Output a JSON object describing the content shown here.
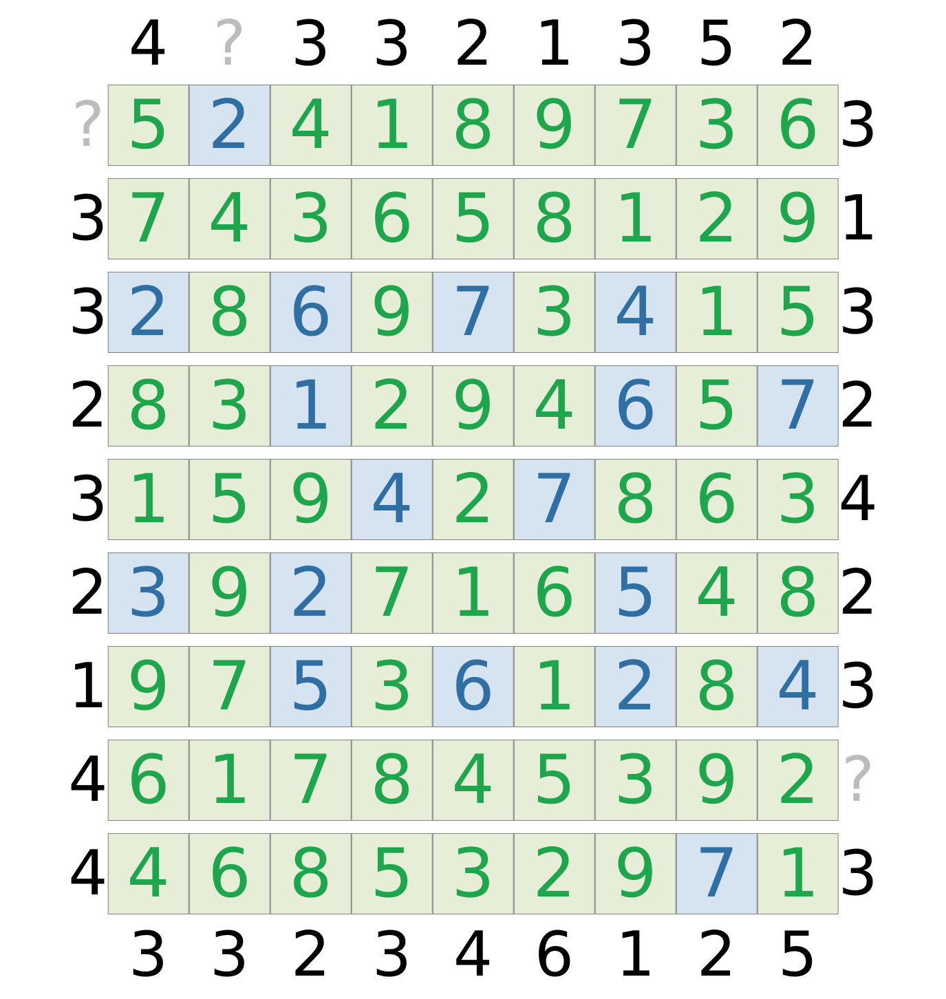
{
  "puzzle": {
    "type": "skyscrapers",
    "size": 9,
    "clues": {
      "top": [
        4,
        "?",
        3,
        3,
        2,
        1,
        3,
        5,
        2
      ],
      "bottom": [
        3,
        3,
        2,
        3,
        4,
        6,
        1,
        2,
        5
      ],
      "left": [
        "?",
        3,
        3,
        2,
        3,
        2,
        1,
        4,
        4
      ],
      "right": [
        3,
        1,
        3,
        2,
        4,
        2,
        3,
        "?",
        3
      ]
    },
    "grid": [
      [
        {
          "v": 5,
          "s": "green"
        },
        {
          "v": 2,
          "s": "blue"
        },
        {
          "v": 4,
          "s": "green"
        },
        {
          "v": 1,
          "s": "green"
        },
        {
          "v": 8,
          "s": "green"
        },
        {
          "v": 9,
          "s": "green"
        },
        {
          "v": 7,
          "s": "green"
        },
        {
          "v": 3,
          "s": "green"
        },
        {
          "v": 6,
          "s": "green"
        }
      ],
      [
        {
          "v": 7,
          "s": "green"
        },
        {
          "v": 4,
          "s": "green"
        },
        {
          "v": 3,
          "s": "green"
        },
        {
          "v": 6,
          "s": "green"
        },
        {
          "v": 5,
          "s": "green"
        },
        {
          "v": 8,
          "s": "green"
        },
        {
          "v": 1,
          "s": "green"
        },
        {
          "v": 2,
          "s": "green"
        },
        {
          "v": 9,
          "s": "green"
        }
      ],
      [
        {
          "v": 2,
          "s": "blue"
        },
        {
          "v": 8,
          "s": "green"
        },
        {
          "v": 6,
          "s": "blue"
        },
        {
          "v": 9,
          "s": "green"
        },
        {
          "v": 7,
          "s": "blue"
        },
        {
          "v": 3,
          "s": "green"
        },
        {
          "v": 4,
          "s": "blue"
        },
        {
          "v": 1,
          "s": "green"
        },
        {
          "v": 5,
          "s": "green"
        }
      ],
      [
        {
          "v": 8,
          "s": "green"
        },
        {
          "v": 3,
          "s": "green"
        },
        {
          "v": 1,
          "s": "blue"
        },
        {
          "v": 2,
          "s": "green"
        },
        {
          "v": 9,
          "s": "green"
        },
        {
          "v": 4,
          "s": "green"
        },
        {
          "v": 6,
          "s": "blue"
        },
        {
          "v": 5,
          "s": "green"
        },
        {
          "v": 7,
          "s": "blue"
        }
      ],
      [
        {
          "v": 1,
          "s": "green"
        },
        {
          "v": 5,
          "s": "green"
        },
        {
          "v": 9,
          "s": "green"
        },
        {
          "v": 4,
          "s": "blue"
        },
        {
          "v": 2,
          "s": "green"
        },
        {
          "v": 7,
          "s": "blue"
        },
        {
          "v": 8,
          "s": "green"
        },
        {
          "v": 6,
          "s": "green"
        },
        {
          "v": 3,
          "s": "green"
        }
      ],
      [
        {
          "v": 3,
          "s": "blue"
        },
        {
          "v": 9,
          "s": "green"
        },
        {
          "v": 2,
          "s": "blue"
        },
        {
          "v": 7,
          "s": "green"
        },
        {
          "v": 1,
          "s": "green"
        },
        {
          "v": 6,
          "s": "green"
        },
        {
          "v": 5,
          "s": "blue"
        },
        {
          "v": 4,
          "s": "green"
        },
        {
          "v": 8,
          "s": "green"
        }
      ],
      [
        {
          "v": 9,
          "s": "green"
        },
        {
          "v": 7,
          "s": "green"
        },
        {
          "v": 5,
          "s": "blue"
        },
        {
          "v": 3,
          "s": "green"
        },
        {
          "v": 6,
          "s": "blue"
        },
        {
          "v": 1,
          "s": "green"
        },
        {
          "v": 2,
          "s": "blue"
        },
        {
          "v": 8,
          "s": "green"
        },
        {
          "v": 4,
          "s": "blue"
        }
      ],
      [
        {
          "v": 6,
          "s": "green"
        },
        {
          "v": 1,
          "s": "green"
        },
        {
          "v": 7,
          "s": "green"
        },
        {
          "v": 8,
          "s": "green"
        },
        {
          "v": 4,
          "s": "green"
        },
        {
          "v": 5,
          "s": "green"
        },
        {
          "v": 3,
          "s": "green"
        },
        {
          "v": 9,
          "s": "green"
        },
        {
          "v": 2,
          "s": "green"
        }
      ],
      [
        {
          "v": 4,
          "s": "green"
        },
        {
          "v": 6,
          "s": "green"
        },
        {
          "v": 8,
          "s": "green"
        },
        {
          "v": 5,
          "s": "green"
        },
        {
          "v": 3,
          "s": "green"
        },
        {
          "v": 2,
          "s": "green"
        },
        {
          "v": 9,
          "s": "green"
        },
        {
          "v": 7,
          "s": "blue"
        },
        {
          "v": 1,
          "s": "green"
        }
      ]
    ]
  }
}
